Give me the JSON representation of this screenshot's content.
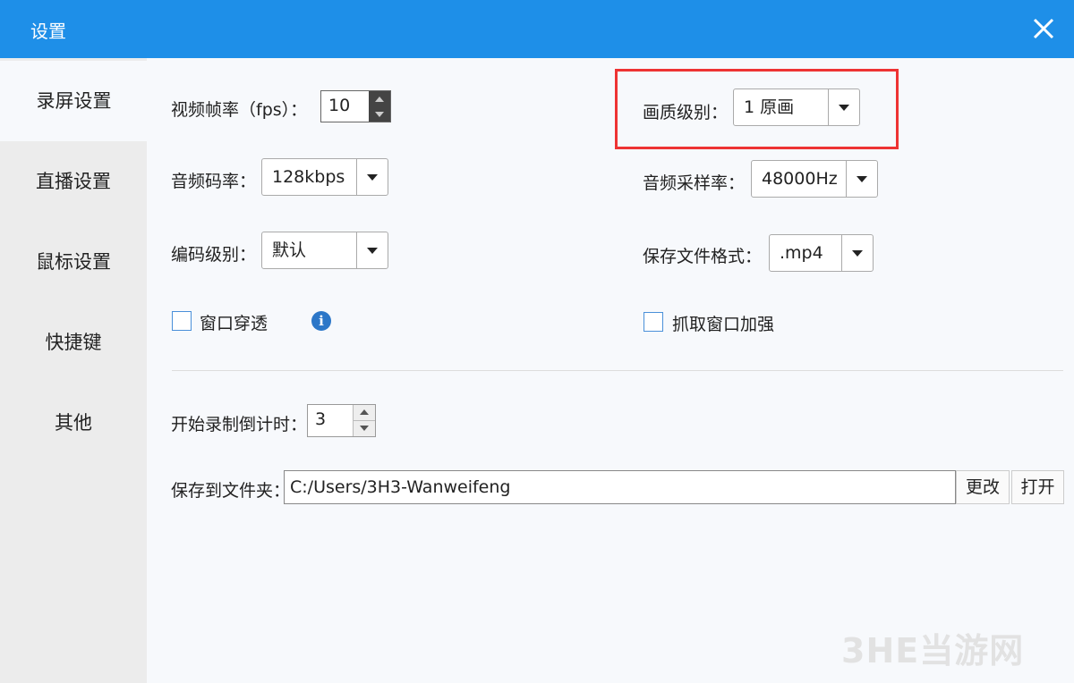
{
  "window": {
    "title": "设置"
  },
  "sidebar": {
    "items": [
      {
        "label": "录屏设置",
        "active": true
      },
      {
        "label": "直播设置"
      },
      {
        "label": "鼠标设置"
      },
      {
        "label": "快捷键"
      },
      {
        "label": "其他"
      }
    ]
  },
  "settings": {
    "fps_label": "视频帧率（fps）：",
    "fps_value": "10",
    "quality_label": "画质级别：",
    "quality_value": "1 原画",
    "audio_bitrate_label": "音频码率：",
    "audio_bitrate_value": "128kbps",
    "sample_rate_label": "音频采样率：",
    "sample_rate_value": "48000Hz",
    "encode_level_label": "编码级别：",
    "encode_level_value": "默认",
    "file_format_label": "保存文件格式：",
    "file_format_value": ".mp4",
    "window_through_label": "窗口穿透",
    "info_icon": "i",
    "capture_enhance_label": "抓取窗口加强",
    "countdown_label": "开始录制倒计时：",
    "countdown_value": "3",
    "save_folder_label": "保存到文件夹：",
    "save_folder_value": "C:/Users/3H3-Wanweifeng",
    "change_button": "更改",
    "open_button": "打开"
  },
  "watermark": "3HE当游网",
  "colors": {
    "titlebar": "#1e8fe8",
    "highlight": "#e33333",
    "checkbox_border": "#4a90d9"
  }
}
